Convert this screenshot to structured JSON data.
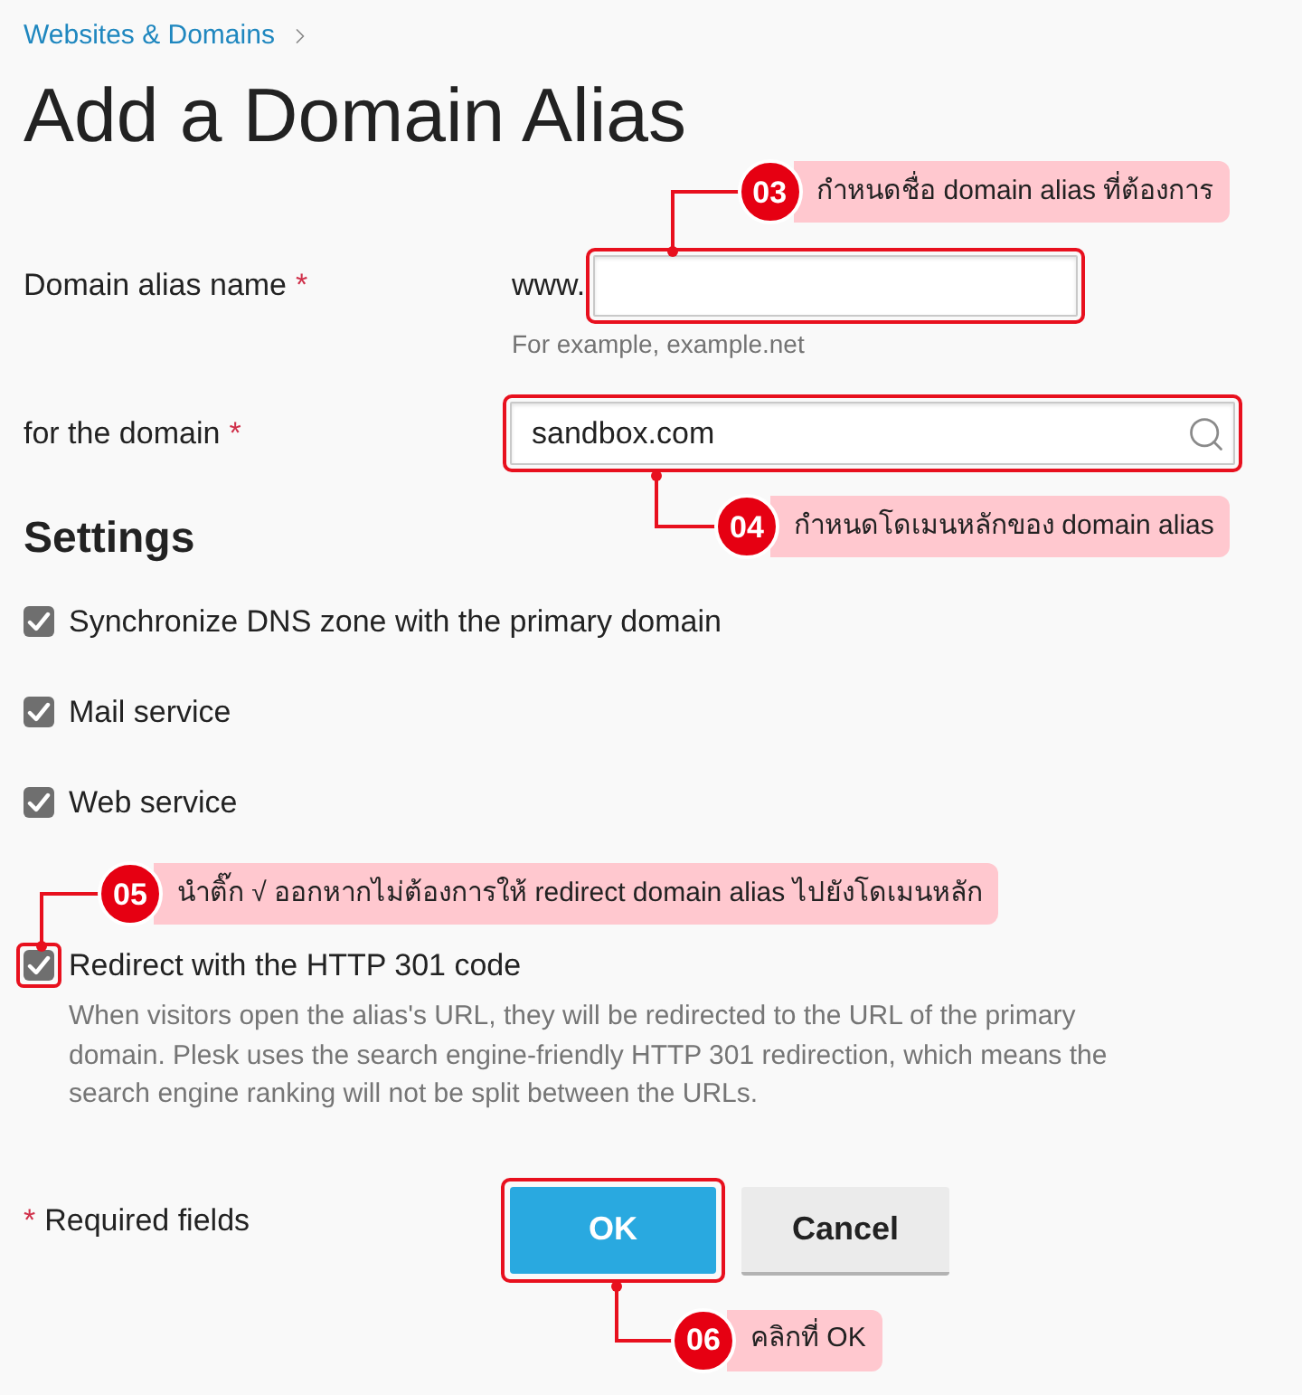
{
  "breadcrumb": {
    "label": "Websites & Domains"
  },
  "title": "Add a Domain Alias",
  "fields": [
    {
      "kind": "prefixed",
      "label": "Domain alias name",
      "required_mark": "*",
      "prefix": "www.",
      "hint": "For example, example.net",
      "annotation": {
        "number": "03",
        "text": "กำหนดชื่อ domain alias ที่ต้องการ"
      }
    },
    {
      "kind": "search",
      "label": "for the domain",
      "required_mark": "*",
      "value": "sandbox.com",
      "annotation": {
        "number": "04",
        "text": "กำหนดโดเมนหลักของ domain alias"
      }
    }
  ],
  "settings": {
    "heading": "Settings",
    "options": [
      {
        "label": "Synchronize DNS zone with the primary domain",
        "checked": true
      },
      {
        "label": "Mail service",
        "checked": true
      },
      {
        "label": "Web service",
        "checked": true
      },
      {
        "label": "Redirect with the HTTP 301 code",
        "checked": true,
        "description": "When visitors open the alias's URL, they will be redirected to the URL of the primary domain. Plesk uses the search engine-friendly HTTP 301 redirection, which means the search engine ranking will not be split between the URLs.",
        "annotation": {
          "number": "05",
          "text": "นำติ๊ก √ ออกหากไม่ต้องการให้ redirect domain alias ไปยังโดเมนหลัก"
        }
      }
    ]
  },
  "required_note": {
    "mark": "*",
    "text": "Required fields"
  },
  "buttons": [
    {
      "label": "OK",
      "kind": "primary",
      "annotation": {
        "number": "06",
        "text": "คลิกที่ OK"
      }
    },
    {
      "label": "Cancel",
      "kind": "secondary"
    }
  ]
}
